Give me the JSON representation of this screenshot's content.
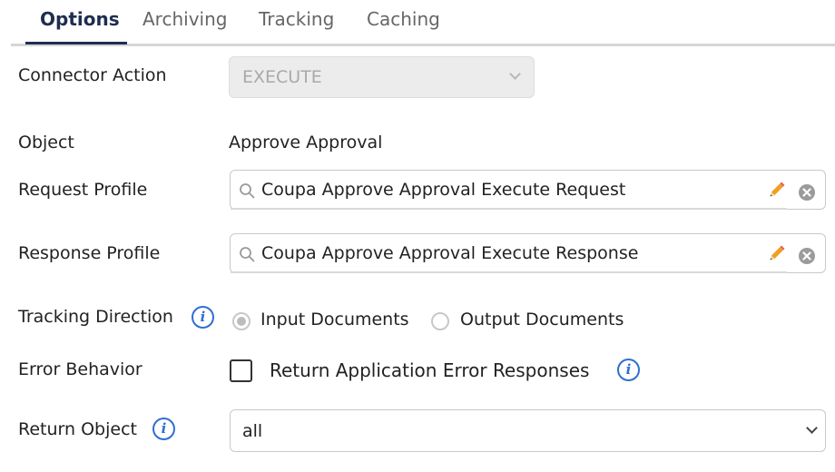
{
  "tabs": [
    {
      "label": "Options",
      "active": true
    },
    {
      "label": "Archiving",
      "active": false
    },
    {
      "label": "Tracking",
      "active": false
    },
    {
      "label": "Caching",
      "active": false
    }
  ],
  "colors": {
    "accent": "#1f2d4f",
    "info": "#2f6fd0",
    "pencil": "#f0a020"
  },
  "form": {
    "connector_action": {
      "label": "Connector Action",
      "value": "EXECUTE",
      "disabled": true,
      "icon": "chevron-down-icon"
    },
    "object": {
      "label": "Object",
      "value": "Approve Approval"
    },
    "request_profile": {
      "label": "Request Profile",
      "value": "Coupa Approve Approval Execute Request",
      "icons": [
        "search-icon",
        "pencil-icon",
        "clear-icon"
      ]
    },
    "response_profile": {
      "label": "Response Profile",
      "value": "Coupa Approve Approval Execute Response",
      "icons": [
        "search-icon",
        "pencil-icon",
        "clear-icon"
      ]
    },
    "tracking_direction": {
      "label": "Tracking Direction",
      "info_icon": "info-icon",
      "options": [
        {
          "label": "Input Documents",
          "selected": true
        },
        {
          "label": "Output Documents",
          "selected": false
        }
      ]
    },
    "error_behavior": {
      "label": "Error Behavior",
      "checkbox_label": "Return Application Error Responses",
      "checked": false,
      "info_icon": "info-icon"
    },
    "return_object": {
      "label": "Return Object",
      "value": "all",
      "info_icon": "info-icon",
      "icon": "chevron-down-icon"
    }
  }
}
